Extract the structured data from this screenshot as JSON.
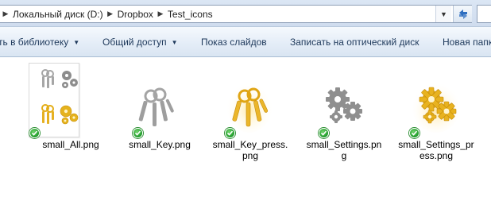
{
  "address": {
    "crumbs": [
      "Локальный диск (D:)",
      "Dropbox",
      "Test_icons"
    ]
  },
  "toolbar": {
    "library_label": "ть в библиотеку",
    "share_label": "Общий доступ",
    "slideshow_label": "Показ слайдов",
    "burn_label": "Записать на оптический диск",
    "new_folder_label": "Новая папка"
  },
  "files": [
    {
      "name_line1": "small_All.png",
      "name_line2": "",
      "name_line3": "",
      "icon": "keys-and-gears-icon",
      "sync": "synced"
    },
    {
      "name_line1": "small_Key.png",
      "name_line2": "",
      "name_line3": "",
      "icon": "keys-gray-icon",
      "sync": "synced"
    },
    {
      "name_line1": "small_Key_press.",
      "name_line2": "png",
      "name_line3": "",
      "icon": "keys-gold-icon",
      "sync": "synced"
    },
    {
      "name_line1": "small_Settings.pn",
      "name_line2": "g",
      "name_line3": "",
      "icon": "gears-gray-icon",
      "sync": "synced"
    },
    {
      "name_line1": "small_Settings_pr",
      "name_line2": "ess.png",
      "name_line3": "",
      "icon": "gears-gold-icon",
      "sync": "synced"
    }
  ],
  "colors": {
    "gray_icon": "#9a9a9a",
    "gold_icon": "#e8b520",
    "sync_ok": "#2aa23a"
  }
}
